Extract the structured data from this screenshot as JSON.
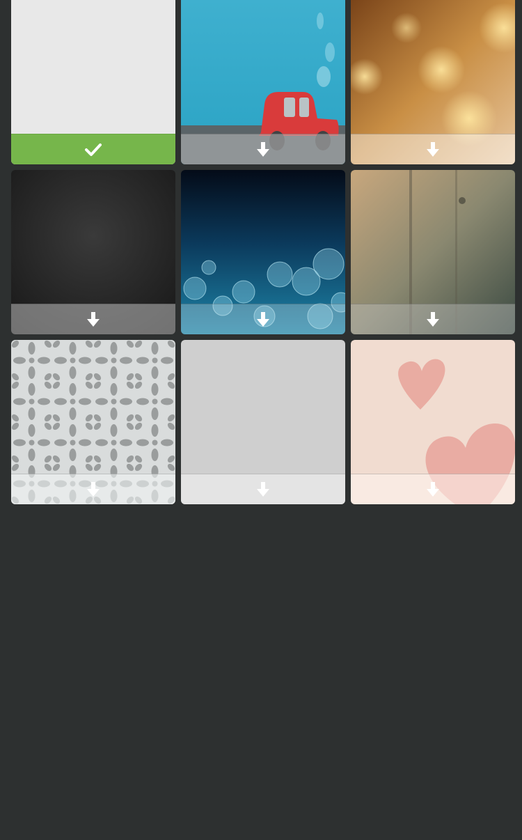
{
  "colors": {
    "background": "#2d3030",
    "selected_bar": "#76b64b",
    "icon": "#ffffff"
  },
  "wallpapers": [
    {
      "theme": "plain-light-gray",
      "state": "selected",
      "icon": "checkmark-icon"
    },
    {
      "theme": "blue-sky-red-car",
      "state": "downloadable",
      "icon": "download-arrow-icon"
    },
    {
      "theme": "golden-bokeh",
      "state": "downloadable",
      "icon": "download-arrow-icon"
    },
    {
      "theme": "dark-leather",
      "state": "downloadable",
      "icon": "download-arrow-icon"
    },
    {
      "theme": "blue-bokeh-night",
      "state": "downloadable",
      "icon": "download-arrow-icon"
    },
    {
      "theme": "foggy-window",
      "state": "downloadable",
      "icon": "download-arrow-icon"
    },
    {
      "theme": "gray-damask-pattern",
      "state": "downloadable",
      "icon": "download-arrow-icon"
    },
    {
      "theme": "plain-silver-texture",
      "state": "downloadable",
      "icon": "download-arrow-icon"
    },
    {
      "theme": "pink-hearts",
      "state": "downloadable",
      "icon": "download-arrow-icon"
    }
  ]
}
